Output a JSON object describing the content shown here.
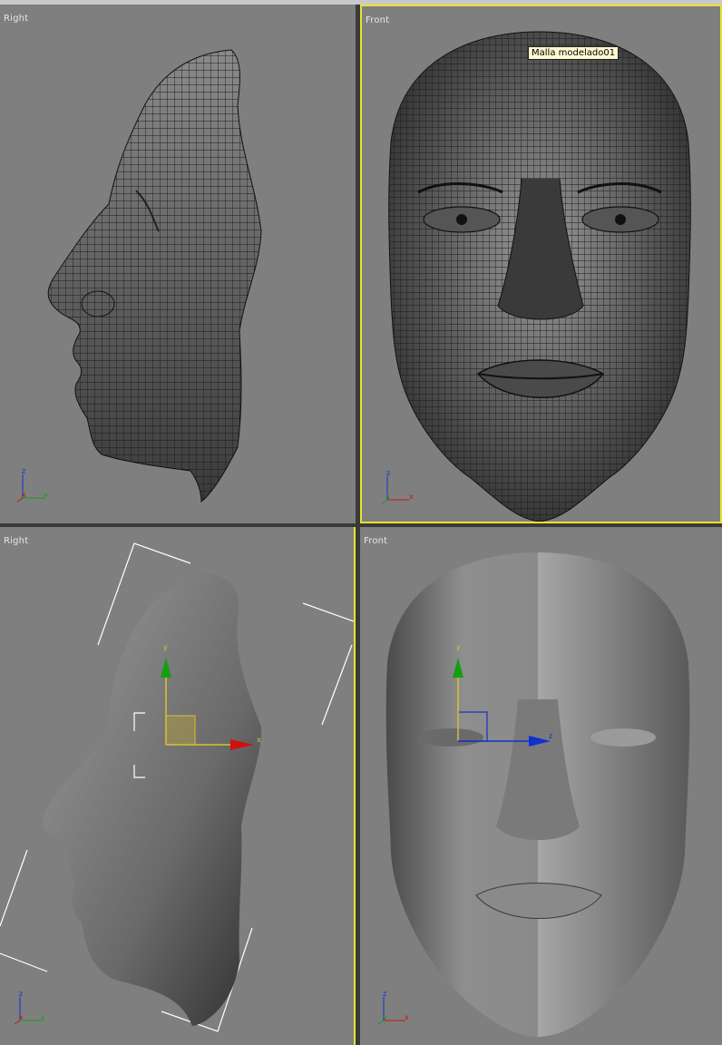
{
  "viewports": {
    "top_left": {
      "label": "Right",
      "gizmo": {
        "vertical": "z",
        "left": "x",
        "right": "y"
      }
    },
    "top_right": {
      "label": "Front",
      "tooltip": "Malla modelado01",
      "gizmo": {
        "vertical": "z",
        "left": "y",
        "right": "x"
      }
    },
    "bottom_left": {
      "label": "Right",
      "move_gizmo": {
        "up": "y",
        "right": "x"
      },
      "gizmo": {
        "vertical": "z",
        "left": "x",
        "right": "y"
      }
    },
    "bottom_right": {
      "label": "Front",
      "move_gizmo": {
        "up": "y",
        "right": "z"
      },
      "gizmo": {
        "vertical": "z",
        "left": "y",
        "right": "x"
      }
    }
  },
  "colors": {
    "viewport_bg": "#7f7f7f",
    "active_border": "#e8e230",
    "axis_x": "#d01010",
    "axis_y": "#10a010",
    "axis_z": "#1030d0"
  }
}
